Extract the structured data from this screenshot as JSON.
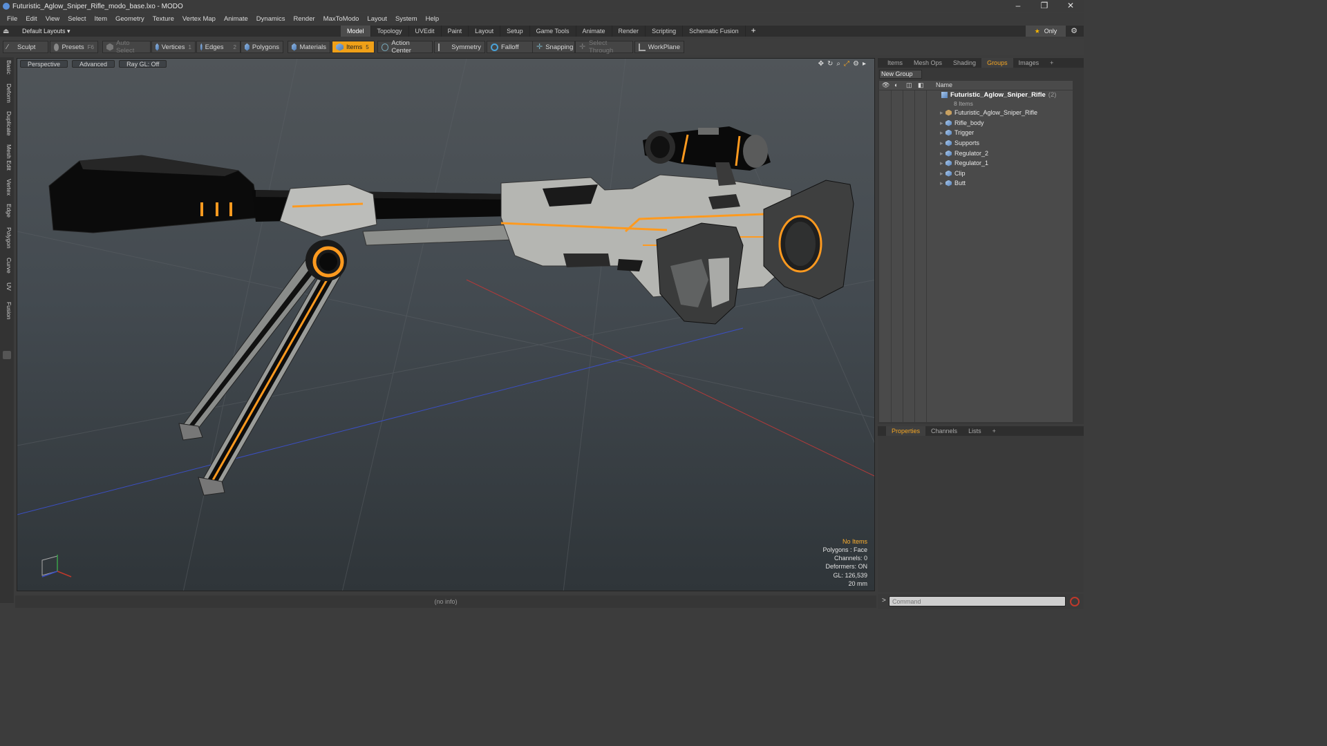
{
  "window": {
    "title": "Futuristic_Aglow_Sniper_Rifle_modo_base.lxo - MODO",
    "controls": [
      "–",
      "❐",
      "✕"
    ]
  },
  "menu": [
    "File",
    "Edit",
    "View",
    "Select",
    "Item",
    "Geometry",
    "Texture",
    "Vertex Map",
    "Animate",
    "Dynamics",
    "Render",
    "MaxToModo",
    "Layout",
    "System",
    "Help"
  ],
  "layout": {
    "selector": "Default Layouts ▾",
    "tabs": [
      "Model",
      "Topology",
      "UVEdit",
      "Paint",
      "Layout",
      "Setup",
      "Game Tools",
      "Animate",
      "Render",
      "Scripting",
      "Schematic Fusion"
    ],
    "active_tab": "Model",
    "only_label": "Only"
  },
  "toolbar": {
    "sculpt": "Sculpt",
    "presets": "Presets",
    "presets_key": "F6",
    "auto_select": "Auto Select",
    "vertices": "Vertices",
    "vertices_key": "1",
    "edges": "Edges",
    "edges_key": "2",
    "polygons": "Polygons",
    "materials": "Materials",
    "items": "Items",
    "items_key": "5",
    "action_center": "Action Center",
    "symmetry": "Symmetry",
    "falloff": "Falloff",
    "snapping": "Snapping",
    "select_through": "Select Through",
    "workplane": "WorkPlane"
  },
  "left_tabs": [
    "Basic",
    "Deform",
    "Duplicate",
    "Mesh Edit",
    "Vertex",
    "Edge",
    "Polygon",
    "Curve",
    "UV",
    "Fusion"
  ],
  "viewport": {
    "view": "Perspective",
    "shading": "Advanced",
    "raygl": "Ray GL: Off",
    "info": {
      "no_items": "No Items",
      "polygons": "Polygons : Face",
      "channels": "Channels: 0",
      "deformers": "Deformers: ON",
      "gl": "GL: 126,539",
      "scale": "20 mm"
    }
  },
  "right_panel": {
    "tabs": [
      "Items",
      "Mesh Ops",
      "Shading",
      "Groups",
      "Images",
      "+"
    ],
    "active_tab": "Groups",
    "new_group": "New Group",
    "name_header": "Name",
    "group": {
      "name": "Futuristic_Aglow_Sniper_Rifle",
      "count": "(2)",
      "items_count": "8 Items"
    },
    "items": [
      "Futuristic_Aglow_Sniper_Rifle",
      "Rifle_body",
      "Trigger",
      "Supports",
      "Regulator_2",
      "Regulator_1",
      "Clip",
      "Butt"
    ]
  },
  "bottom_panel": {
    "tabs": [
      "Properties",
      "Channels",
      "Lists",
      "+"
    ],
    "active_tab": "Properties"
  },
  "status": {
    "info": "(no info)",
    "command_placeholder": "Command"
  },
  "colors": {
    "accent": "#f0a018",
    "glow": "#ff9a1f",
    "axis_x": "#c0392b",
    "axis_z": "#3b4fc4"
  }
}
